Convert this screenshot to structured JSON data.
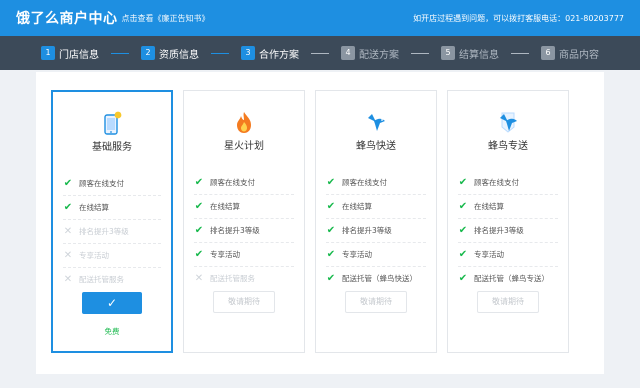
{
  "header": {
    "title": "饿了么商户中心",
    "link": "点击查看《廉正告知书》",
    "help": "如开店过程遇到问题，可以拨打客服电话：021-80203777"
  },
  "steps": [
    {
      "num": "1",
      "label": "门店信息",
      "active": true
    },
    {
      "num": "2",
      "label": "资质信息",
      "active": true
    },
    {
      "num": "3",
      "label": "合作方案",
      "active": true
    },
    {
      "num": "4",
      "label": "配送方案",
      "active": false
    },
    {
      "num": "5",
      "label": "结算信息",
      "active": false
    },
    {
      "num": "6",
      "label": "商品内容",
      "active": false
    }
  ],
  "plans": [
    {
      "title": "基础服务",
      "icon": "phone-icon",
      "features": [
        {
          "text": "顾客在线支付",
          "ok": true
        },
        {
          "text": "在线结算",
          "ok": true
        },
        {
          "text": "排名提升3等级",
          "ok": false
        },
        {
          "text": "专享活动",
          "ok": false
        },
        {
          "text": "配送托管服务",
          "ok": false
        }
      ],
      "button": "✓",
      "price": "免费"
    },
    {
      "title": "星火计划",
      "icon": "fire-icon",
      "features": [
        {
          "text": "顾客在线支付",
          "ok": true
        },
        {
          "text": "在线结算",
          "ok": true
        },
        {
          "text": "排名提升3等级",
          "ok": true
        },
        {
          "text": "专享活动",
          "ok": true
        },
        {
          "text": "配送托管服务",
          "ok": false
        }
      ],
      "button": "敬请期待"
    },
    {
      "title": "蜂鸟快送",
      "icon": "bird-icon",
      "features": [
        {
          "text": "顾客在线支付",
          "ok": true
        },
        {
          "text": "在线结算",
          "ok": true
        },
        {
          "text": "排名提升3等级",
          "ok": true
        },
        {
          "text": "专享活动",
          "ok": true
        },
        {
          "text": "配送托管（蜂鸟快送）",
          "ok": true
        }
      ],
      "button": "敬请期待"
    },
    {
      "title": "蜂鸟专送",
      "icon": "bird-badge-icon",
      "features": [
        {
          "text": "顾客在线支付",
          "ok": true
        },
        {
          "text": "在线结算",
          "ok": true
        },
        {
          "text": "排名提升3等级",
          "ok": true
        },
        {
          "text": "专享活动",
          "ok": true
        },
        {
          "text": "配送托管（蜂鸟专送）",
          "ok": true
        }
      ],
      "button": "敬请期待"
    }
  ],
  "colors": {
    "accent": "#1e8fe1",
    "ok": "#19b94d",
    "dark": "#3c4a59"
  }
}
